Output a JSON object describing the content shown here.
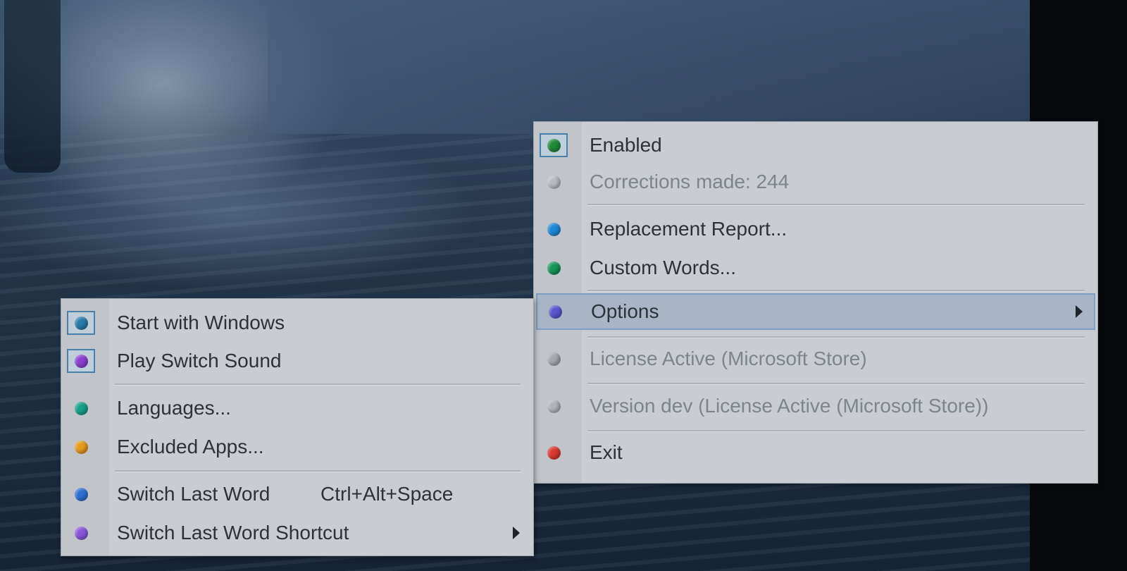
{
  "main_menu": {
    "items": [
      {
        "label": "Enabled",
        "icon": "green-dot-icon",
        "color": "#1f8a3a",
        "checked": true
      },
      {
        "label": "Corrections made: 244",
        "icon": "gray-dot-icon",
        "color": "#b8bcc1",
        "disabled": true
      },
      {
        "label": "Replacement Report...",
        "icon": "blue-dot-icon",
        "color": "#1e88d6"
      },
      {
        "label": "Custom Words...",
        "icon": "green-dot-icon",
        "color": "#17945a"
      },
      {
        "label": "Options",
        "icon": "violet-dot-icon",
        "color": "#5a55d0",
        "highlighted": true,
        "has_submenu": true
      },
      {
        "label": "License Active (Microsoft Store)",
        "icon": "gray-dot-icon",
        "color": "#a3a7ad",
        "disabled": true
      },
      {
        "label": "Version dev (License Active (Microsoft Store))",
        "icon": "gray-dot-icon",
        "color": "#b0b4b9",
        "disabled": true
      },
      {
        "label": "Exit",
        "icon": "red-dot-icon",
        "color": "#d83a2f"
      }
    ]
  },
  "options_submenu": {
    "items": [
      {
        "label": "Start with Windows",
        "icon": "teal-blue-dot-icon",
        "color": "#2a7aa8",
        "checked": true
      },
      {
        "label": "Play Switch Sound",
        "icon": "purple-dot-icon",
        "color": "#8a3fd0",
        "checked": true
      },
      {
        "label": "Languages...",
        "icon": "teal-dot-icon",
        "color": "#14a088"
      },
      {
        "label": "Excluded Apps...",
        "icon": "orange-dot-icon",
        "color": "#e39a1c"
      },
      {
        "label": "Switch Last Word",
        "shortcut": "Ctrl+Alt+Space",
        "icon": "blue-dot-icon",
        "color": "#2d6fd2"
      },
      {
        "label": "Switch Last Word Shortcut",
        "icon": "purple-dot-icon",
        "color": "#8757d8",
        "has_submenu": true
      }
    ]
  }
}
